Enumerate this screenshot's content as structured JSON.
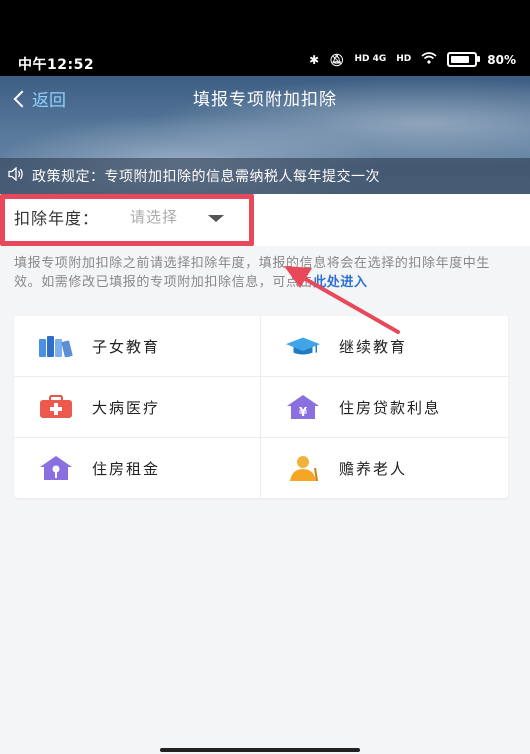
{
  "status_bar": {
    "time": "中午12:52",
    "signal_1": "HD 4G",
    "signal_2": "HD",
    "battery": "80%",
    "battery_level": 0.8
  },
  "header": {
    "back_label": "返回",
    "title": "填报专项附加扣除"
  },
  "notice": {
    "text": "政策规定：专项附加扣除的信息需纳税人每年提交一次"
  },
  "year_selector": {
    "label": "扣除年度：",
    "placeholder": "请选择"
  },
  "hint": {
    "text": "填报专项附加扣除之前请选择扣除年度，填报的信息将会在选择的扣除年度中生效。如需修改已填报的专项附加扣除信息，可点击",
    "link": "此处进入"
  },
  "categories": [
    {
      "label": "子女教育",
      "icon": "books-icon"
    },
    {
      "label": "继续教育",
      "icon": "graduation-cap-icon"
    },
    {
      "label": "大病医疗",
      "icon": "medical-kit-icon"
    },
    {
      "label": "住房贷款利息",
      "icon": "house-yen-icon"
    },
    {
      "label": "住房租金",
      "icon": "house-key-icon"
    },
    {
      "label": "赡养老人",
      "icon": "elderly-person-icon"
    }
  ],
  "colors": {
    "annotation_red": "#e8495a",
    "link_blue": "#2b6fd6"
  }
}
